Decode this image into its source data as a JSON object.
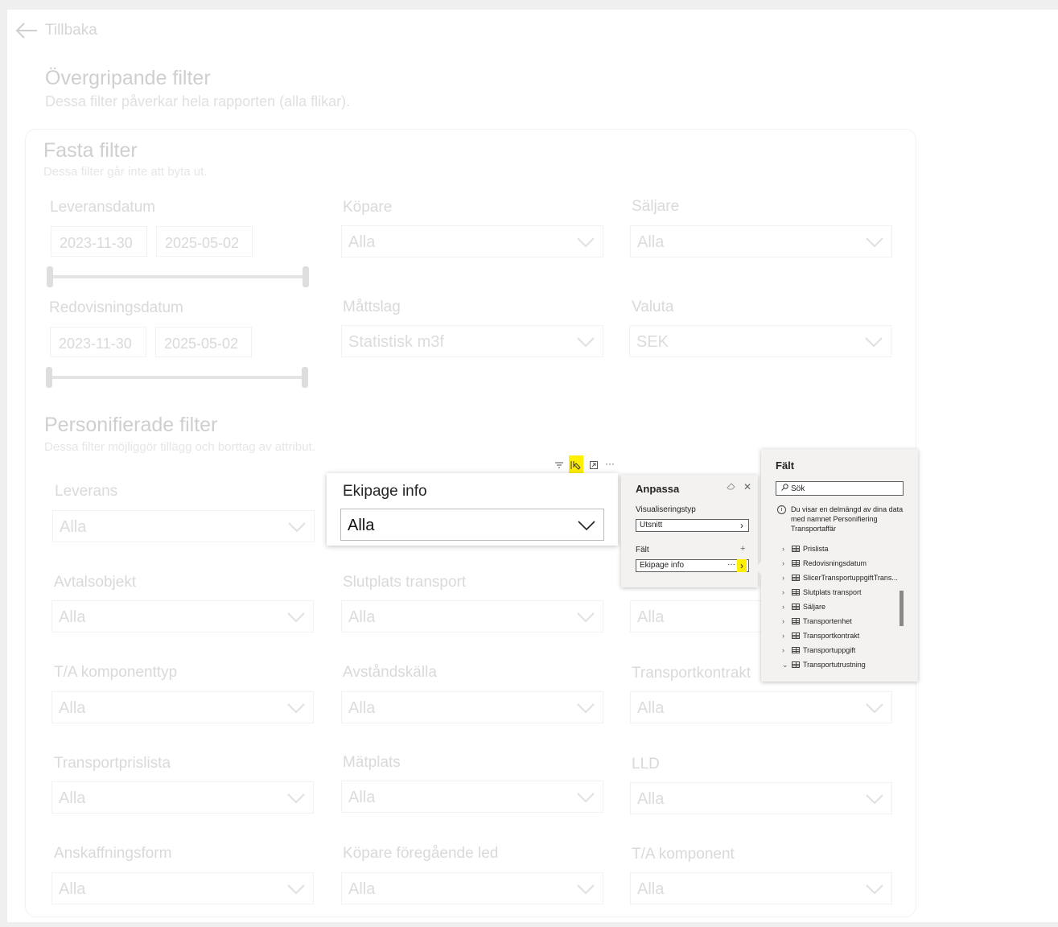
{
  "nav": {
    "back_label": "Tillbaka"
  },
  "header": {
    "title": "Övergripande filter",
    "subtitle": "Dessa filter påverkar hela rapporten (alla flikar)."
  },
  "fixed": {
    "title": "Fasta filter",
    "subtitle": "Dessa filter går inte att byta ut.",
    "leveransdatum": {
      "label": "Leveransdatum",
      "from": "2023-11-30",
      "to": "2025-05-02"
    },
    "redovisningsdatum": {
      "label": "Redovisningsdatum",
      "from": "2023-11-30",
      "to": "2025-05-02"
    },
    "kopare": {
      "label": "Köpare",
      "value": "Alla"
    },
    "saljare": {
      "label": "Säljare",
      "value": "Alla"
    },
    "mattslag": {
      "label": "Måttslag",
      "value": "Statistisk m3f"
    },
    "valuta": {
      "label": "Valuta",
      "value": "SEK"
    }
  },
  "personal": {
    "title": "Personifierade filter",
    "subtitle": "Dessa filter möjliggör tillägg och borttag av attribut.",
    "filters": [
      {
        "label": "Leverans",
        "value": "Alla"
      },
      {
        "label": "Avtalsobjekt",
        "value": "Alla"
      },
      {
        "label": "Slutplats transport",
        "value": "Alla"
      },
      {
        "label": "",
        "value": "Alla"
      },
      {
        "label": "T/A komponenttyp",
        "value": "Alla"
      },
      {
        "label": "Avståndskälla",
        "value": "Alla"
      },
      {
        "label": "Transportkontrakt",
        "value": "Alla"
      },
      {
        "label": "Transportprislista",
        "value": "Alla"
      },
      {
        "label": "Mätplats",
        "value": "Alla"
      },
      {
        "label": "LLD",
        "value": "Alla"
      },
      {
        "label": "Anskaffningsform",
        "value": "Alla"
      },
      {
        "label": "Köpare föregående led",
        "value": "Alla"
      },
      {
        "label": "T/A komponent",
        "value": "Alla"
      }
    ]
  },
  "visual": {
    "title": "Ekipage info",
    "value": "Alla"
  },
  "toolbar": {
    "icons": [
      "filter-icon",
      "edit-icon",
      "focus-icon",
      "more-icon"
    ],
    "highlight": "#ffef00"
  },
  "anpassa": {
    "title": "Anpassa",
    "vis_label": "Visualiseringstyp",
    "vis_value": "Utsnitt",
    "field_label": "Fält",
    "field_add": "+",
    "field_value": "Ekipage info",
    "field_more": "···",
    "close": "✕"
  },
  "falt": {
    "title": "Fält",
    "search_placeholder": "Sök",
    "info": "Du visar en delmängd av dina data med namnet Personifiering Transportaffär",
    "items": [
      {
        "label": "Prislista",
        "chevron": "›"
      },
      {
        "label": "Redovisningsdatum",
        "chevron": "›"
      },
      {
        "label": "SlicerTransportuppgiftTrans...",
        "chevron": "›"
      },
      {
        "label": "Slutplats transport",
        "chevron": "›"
      },
      {
        "label": "Säljare",
        "chevron": "›"
      },
      {
        "label": "Transportenhet",
        "chevron": "›"
      },
      {
        "label": "Transportkontrakt",
        "chevron": "›"
      },
      {
        "label": "Transportuppgift",
        "chevron": "›"
      },
      {
        "label": "Transportutrustning",
        "chevron": "⌄"
      }
    ]
  }
}
